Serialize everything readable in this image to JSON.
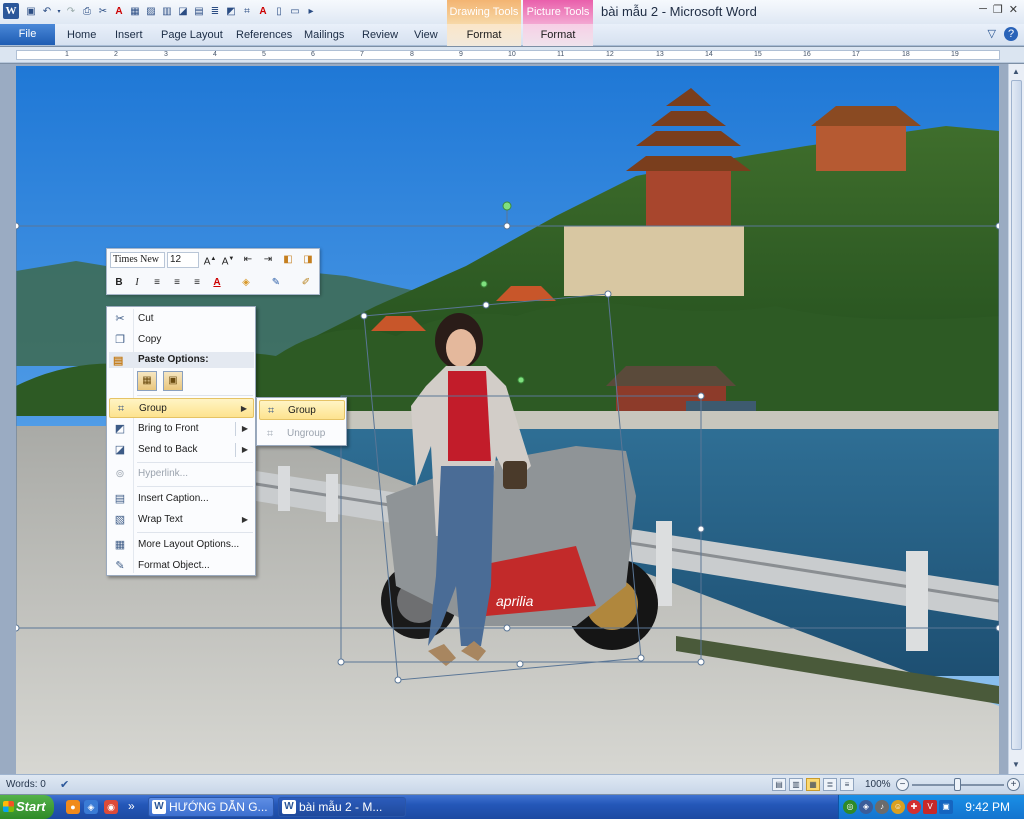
{
  "app": {
    "doc_title": "bài mẫu 2  -  Microsoft Word",
    "logo_letter": "W",
    "qat_icons": [
      "save-icon",
      "undo-icon",
      "redo-icon",
      "print-icon",
      "cut-icon",
      "copy-icon",
      "font-color-icon",
      "draw-table-icon",
      "image-icon",
      "chart-icon",
      "shape-icon",
      "text-box-icon",
      "new-doc-icon",
      "open-icon",
      "more-icon"
    ]
  },
  "context_tabs": {
    "drawing_tools": "Drawing Tools",
    "picture_tools": "Picture Tools",
    "drawing_format": "Format",
    "picture_format": "Format"
  },
  "ribbon": {
    "file": "File",
    "tabs": [
      "Home",
      "Insert",
      "Page Layout",
      "References",
      "Mailings",
      "Review",
      "View"
    ]
  },
  "ruler": {
    "numbers": [
      "1",
      "2",
      "3",
      "4",
      "5",
      "6",
      "7",
      "8",
      "9",
      "10",
      "11",
      "12",
      "13",
      "14",
      "15",
      "16",
      "17",
      "18",
      "19"
    ]
  },
  "mini_toolbar": {
    "font": "Times New",
    "size": "12",
    "row1_icons": [
      "grow-font-icon",
      "shrink-font-icon",
      "decrease-indent-icon",
      "increase-indent-icon",
      "format-painter-icon",
      "styles-icon"
    ],
    "row2": [
      "B",
      "I",
      "≡",
      "≡",
      "≡",
      "A",
      "◈",
      "✎",
      "✐"
    ]
  },
  "context_menu": {
    "items": [
      {
        "label": "Cut",
        "icon": "cut-icon",
        "enabled": true
      },
      {
        "label": "Copy",
        "icon": "copy-icon",
        "enabled": true
      },
      {
        "label": "Paste Options:",
        "icon": "paste-icon",
        "header": true
      },
      {
        "label": "Group",
        "icon": "group-icon",
        "enabled": true,
        "submenu": true,
        "highlighted": true
      },
      {
        "label": "Bring to Front",
        "icon": "bring-front-icon",
        "enabled": true,
        "submenu": true
      },
      {
        "label": "Send to Back",
        "icon": "send-back-icon",
        "enabled": true,
        "submenu": true
      },
      {
        "label": "Hyperlink...",
        "icon": "hyperlink-icon",
        "enabled": false
      },
      {
        "label": "Insert Caption...",
        "icon": "caption-icon",
        "enabled": true
      },
      {
        "label": "Wrap Text",
        "icon": "wrap-text-icon",
        "enabled": true,
        "submenu": true
      },
      {
        "label": "More Layout Options...",
        "icon": "layout-icon",
        "enabled": true
      },
      {
        "label": "Format Object...",
        "icon": "format-object-icon",
        "enabled": true
      }
    ]
  },
  "submenu": {
    "items": [
      {
        "label": "Group",
        "icon": "group-icon",
        "highlighted": true
      },
      {
        "label": "Ungroup",
        "icon": "ungroup-icon",
        "enabled": false
      }
    ]
  },
  "status": {
    "words": "Words: 0",
    "zoom": "100%"
  },
  "taskbar": {
    "start": "Start",
    "chevron": "»",
    "buttons": [
      {
        "label": "HƯỚNG DẪN G...",
        "icon": "word-icon"
      },
      {
        "label": "bài mẫu 2 - M...",
        "icon": "word-icon",
        "active": true
      }
    ],
    "clock": "9:42 PM"
  },
  "colors": {
    "accent": "#2b579a",
    "drawing_tools": "#f3b472",
    "picture_tools": "#e95fab",
    "highlight": "#fde38f"
  }
}
